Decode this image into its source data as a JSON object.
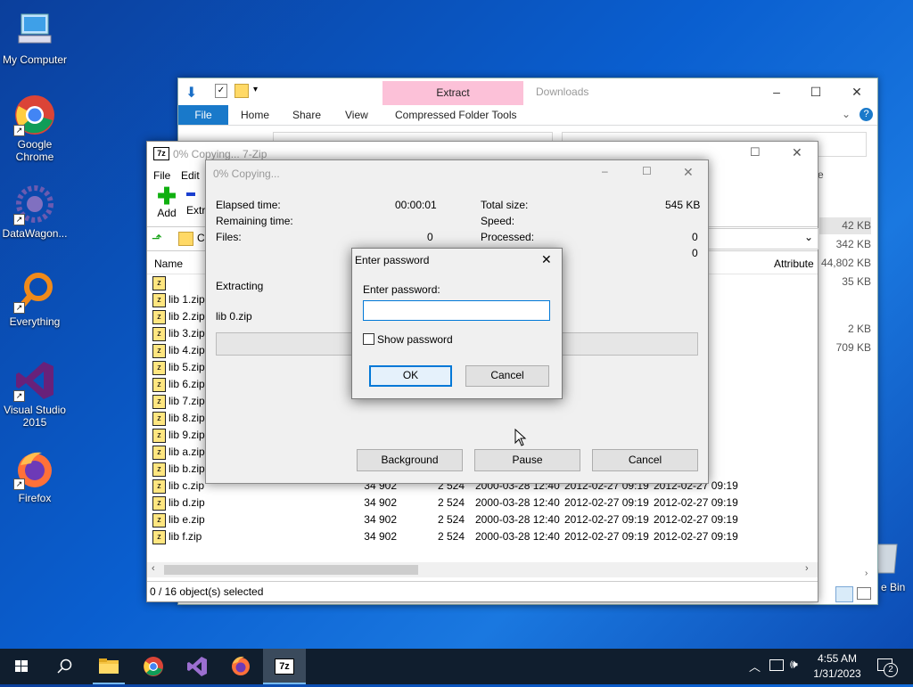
{
  "desktop": {
    "icons": [
      {
        "label": "My Computer"
      },
      {
        "label": "Google Chrome"
      },
      {
        "label": "DataWagon..."
      },
      {
        "label": "Everything"
      },
      {
        "label": "Visual Studio 2015"
      },
      {
        "label": "Firefox"
      }
    ],
    "recycle_bin_label": "e Bin"
  },
  "explorer": {
    "context_tab": "Extract",
    "title": "Downloads",
    "tabs": [
      "File",
      "Home",
      "Share",
      "View",
      "Compressed Folder Tools"
    ],
    "sizes": [
      "42 KB",
      "342 KB",
      "44,802 KB",
      "35 KB",
      "2 KB",
      "709 KB"
    ],
    "col_hint": "e"
  },
  "sevenzip": {
    "title": "0% Copying... 7-Zip",
    "menu": [
      "File",
      "Edit"
    ],
    "toolbar": {
      "add": "Add",
      "extract": "Extr"
    },
    "address_fragment": "C",
    "columns": {
      "name": "Name",
      "attributes": "Attribute"
    },
    "rows": [
      {
        "name": "",
        "size": "",
        "packed": "",
        "modified": "",
        "created": "",
        "accessed": "09:19"
      },
      {
        "name": "lib 1.zip",
        "size": "",
        "packed": "",
        "modified": "",
        "created": "",
        "accessed": "09:19"
      },
      {
        "name": "lib 2.zip",
        "size": "",
        "packed": "",
        "modified": "",
        "created": "",
        "accessed": "09:19"
      },
      {
        "name": "lib 3.zip",
        "size": "",
        "packed": "",
        "modified": "",
        "created": "",
        "accessed": "09:19"
      },
      {
        "name": "lib 4.zip",
        "size": "",
        "packed": "",
        "modified": "",
        "created": "",
        "accessed": "09:19"
      },
      {
        "name": "lib 5.zip",
        "size": "",
        "packed": "",
        "modified": "",
        "created": "",
        "accessed": "09:19"
      },
      {
        "name": "lib 6.zip",
        "size": "",
        "packed": "",
        "modified": "",
        "created": "",
        "accessed": "09:19"
      },
      {
        "name": "lib 7.zip",
        "size": "",
        "packed": "",
        "modified": "",
        "created": "",
        "accessed": "09:19"
      },
      {
        "name": "lib 8.zip",
        "size": "",
        "packed": "",
        "modified": "",
        "created": "",
        "accessed": "09:19"
      },
      {
        "name": "lib 9.zip",
        "size": "",
        "packed": "",
        "modified": "",
        "created": "",
        "accessed": "09:19"
      },
      {
        "name": "lib a.zip",
        "size": "",
        "packed": "",
        "modified": "",
        "created": "",
        "accessed": "09:19"
      },
      {
        "name": "lib b.zip",
        "size": "",
        "packed": "",
        "modified": "",
        "created": "",
        "accessed": "09:19"
      },
      {
        "name": "lib c.zip",
        "size": "34 902",
        "packed": "2 524",
        "modified": "2000-03-28 12:40",
        "created": "2012-02-27 09:19",
        "accessed": "2012-02-27 09:19"
      },
      {
        "name": "lib d.zip",
        "size": "34 902",
        "packed": "2 524",
        "modified": "2000-03-28 12:40",
        "created": "2012-02-27 09:19",
        "accessed": "2012-02-27 09:19"
      },
      {
        "name": "lib e.zip",
        "size": "34 902",
        "packed": "2 524",
        "modified": "2000-03-28 12:40",
        "created": "2012-02-27 09:19",
        "accessed": "2012-02-27 09:19"
      },
      {
        "name": "lib f.zip",
        "size": "34 902",
        "packed": "2 524",
        "modified": "2000-03-28 12:40",
        "created": "2012-02-27 09:19",
        "accessed": "2012-02-27 09:19"
      }
    ],
    "status": "0 / 16 object(s) selected"
  },
  "copying": {
    "title": "0% Copying...",
    "elapsed_label": "Elapsed time:",
    "elapsed_value": "00:00:01",
    "remaining_label": "Remaining time:",
    "files_label": "Files:",
    "files_value": "0",
    "total_label": "Total size:",
    "total_value": "545 KB",
    "speed_label": "Speed:",
    "processed_label": "Processed:",
    "processed_value": "0",
    "extra_value": "0",
    "status": "Extracting",
    "current_file": "lib 0.zip",
    "progress": 0,
    "buttons": {
      "background": "Background",
      "pause": "Pause",
      "cancel": "Cancel"
    }
  },
  "password": {
    "title": "Enter password",
    "prompt": "Enter password:",
    "value": "",
    "show_label": "Show password",
    "ok": "OK",
    "cancel": "Cancel"
  },
  "taskbar": {
    "time": "4:55 AM",
    "date": "1/31/2023",
    "notifications": "2",
    "active_app": "7z"
  }
}
